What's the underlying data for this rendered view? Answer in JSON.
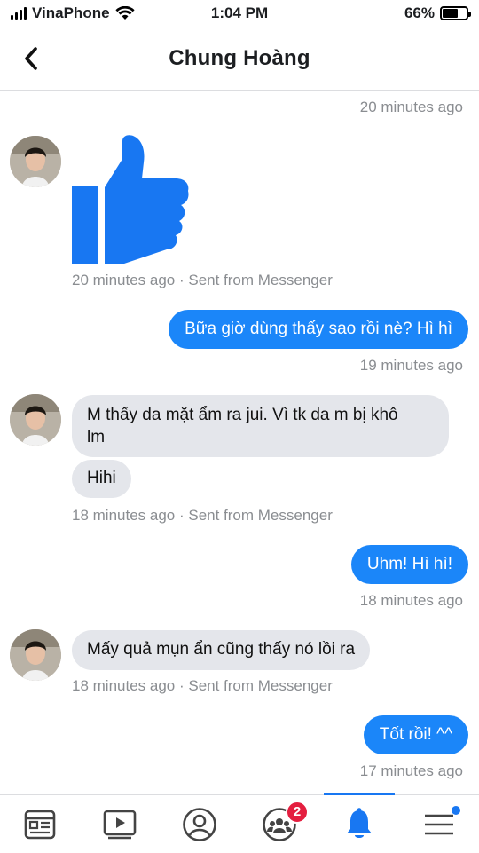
{
  "status_bar": {
    "carrier": "VinaPhone",
    "time": "1:04 PM",
    "battery_percent": "66%",
    "battery_level": 0.66
  },
  "header": {
    "title": "Chung Hoàng",
    "back_icon": "chevron-left-icon"
  },
  "thread": {
    "messages": [
      {
        "kind": "timestamp",
        "text": "20 minutes ago"
      },
      {
        "kind": "incoming-like",
        "icon": "thumbs-up-icon",
        "meta": "20 minutes ago · Sent from Messenger"
      },
      {
        "kind": "outgoing",
        "text": "Bữa giờ dùng thấy sao rồi nè? Hì hì",
        "time": "19 minutes ago"
      },
      {
        "kind": "incoming",
        "lines": [
          "M thấy da mặt ẩm ra jui. Vì tk da m bị khô",
          "lm"
        ]
      },
      {
        "kind": "incoming",
        "text": "Hihi",
        "meta": "18 minutes ago · Sent from Messenger"
      },
      {
        "kind": "outgoing",
        "text": "Uhm! Hì hì!",
        "time": "18 minutes ago"
      },
      {
        "kind": "incoming",
        "text": "Mấy quả mụn ẩn cũng thấy nó lồi ra",
        "meta": "18 minutes ago · Sent from Messenger"
      },
      {
        "kind": "outgoing",
        "text": "Tốt rồi! ^^",
        "time": "17 minutes ago"
      }
    ]
  },
  "tabbar": {
    "tabs": [
      {
        "name": "news-feed",
        "icon": "news-feed-icon"
      },
      {
        "name": "watch",
        "icon": "video-play-icon"
      },
      {
        "name": "profile",
        "icon": "profile-icon"
      },
      {
        "name": "groups",
        "icon": "groups-icon",
        "badge": "2"
      },
      {
        "name": "notifications",
        "icon": "bell-icon",
        "active": true
      },
      {
        "name": "menu",
        "icon": "hamburger-menu-icon",
        "dot": true
      }
    ]
  },
  "colors": {
    "accent": "#1877f2",
    "outgoing_bubble": "#1b86f9",
    "incoming_bubble": "#e4e6eb",
    "meta_text": "#8a8d91",
    "badge": "#e41e3f"
  }
}
